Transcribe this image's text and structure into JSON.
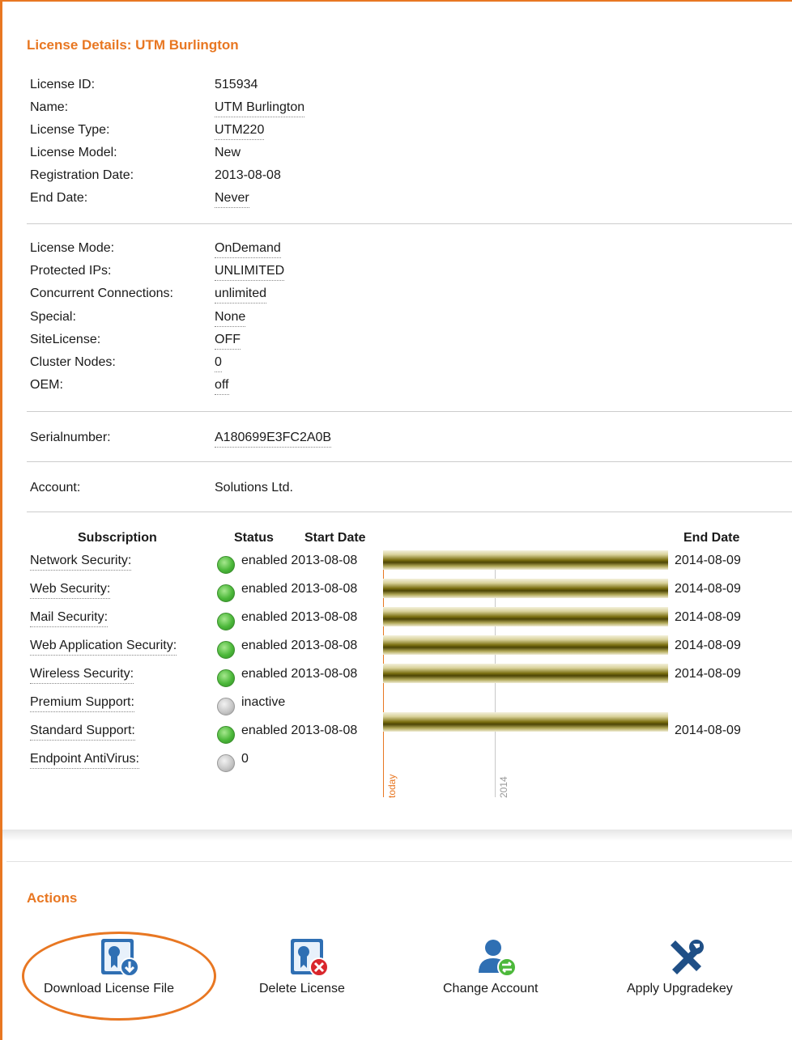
{
  "license": {
    "title": "License Details: UTM Burlington",
    "group1": [
      {
        "label": "License ID:",
        "value": "515934",
        "dotted": false
      },
      {
        "label": "Name:",
        "value": "UTM Burlington",
        "dotted": true
      },
      {
        "label": "License Type:",
        "value": "UTM220",
        "dotted": true
      },
      {
        "label": "License Model:",
        "value": "New",
        "dotted": false
      },
      {
        "label": "Registration Date:",
        "value": "2013-08-08",
        "dotted": false
      },
      {
        "label": "End Date:",
        "value": "Never",
        "dotted": true
      }
    ],
    "group2": [
      {
        "label": "License Mode:",
        "value": "OnDemand"
      },
      {
        "label": "Protected IPs:",
        "value": "UNLIMITED"
      },
      {
        "label": "Concurrent Connections:",
        "value": "unlimited"
      },
      {
        "label": "Special:",
        "value": "None"
      },
      {
        "label": "SiteLicense:",
        "value": "OFF"
      },
      {
        "label": "Cluster Nodes:",
        "value": "0"
      },
      {
        "label": "OEM:",
        "value": "off"
      }
    ],
    "serial": {
      "label": "Serialnumber:",
      "value": "A180699E3FC2A0B"
    },
    "account": {
      "label": "Account:",
      "value": "Solutions Ltd."
    }
  },
  "subscriptions": {
    "headers": {
      "subscription": "Subscription",
      "status": "Status",
      "start": "Start Date",
      "end": "End Date"
    },
    "rows": [
      {
        "name": "Network Security:",
        "status": "enabled",
        "state": "enabled",
        "start": "2013-08-08",
        "end": "2014-08-09"
      },
      {
        "name": "Web Security:",
        "status": "enabled",
        "state": "enabled",
        "start": "2013-08-08",
        "end": "2014-08-09"
      },
      {
        "name": "Mail Security:",
        "status": "enabled",
        "state": "enabled",
        "start": "2013-08-08",
        "end": "2014-08-09"
      },
      {
        "name": "Web Application Security:",
        "status": "enabled",
        "state": "enabled",
        "start": "2013-08-08",
        "end": "2014-08-09"
      },
      {
        "name": "Wireless Security:",
        "status": "enabled",
        "state": "enabled",
        "start": "2013-08-08",
        "end": "2014-08-09"
      },
      {
        "name": "Premium Support:",
        "status": "inactive",
        "state": "inactive",
        "start": "",
        "end": ""
      },
      {
        "name": "Standard Support:",
        "status": "enabled",
        "state": "enabled",
        "start": "2013-08-08",
        "end": "2014-08-09"
      },
      {
        "name": "Endpoint AntiVirus:",
        "status": "0",
        "state": "inactive",
        "start": "",
        "end": ""
      }
    ],
    "timeline": {
      "today_label": "today",
      "year_label": "2014"
    }
  },
  "actions": {
    "title": "Actions",
    "items": [
      {
        "label": "Download License File",
        "icon": "download-license-icon"
      },
      {
        "label": "Delete License",
        "icon": "delete-license-icon"
      },
      {
        "label": "Change Account",
        "icon": "change-account-icon"
      },
      {
        "label": "Apply Upgradekey",
        "icon": "tools-icon"
      }
    ]
  },
  "colors": {
    "accent": "#e87722",
    "enabled": "#4cb83a",
    "bar": "#6b6010",
    "icon_blue": "#2b6cb0"
  }
}
